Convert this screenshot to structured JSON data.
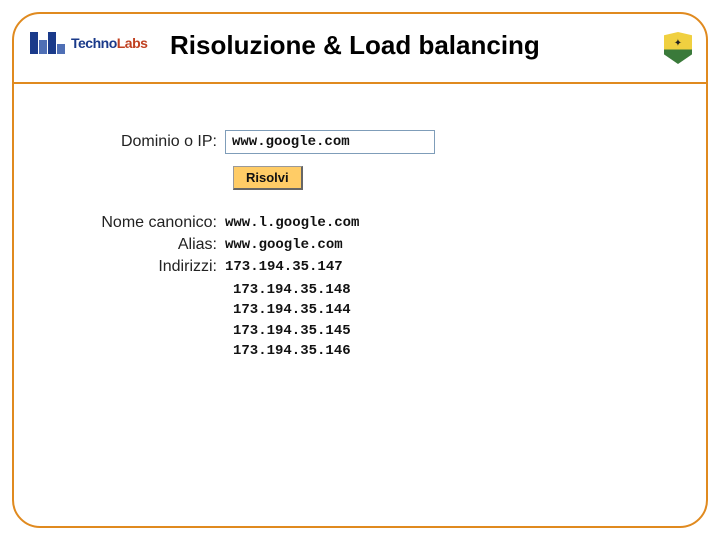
{
  "header": {
    "logo_text_main": "Techno",
    "logo_text_sub": "Labs",
    "title": "Risoluzione & Load balancing"
  },
  "form": {
    "domain_label": "Dominio o IP:",
    "domain_value": "www.google.com",
    "resolve_label": "Risolvi"
  },
  "results": {
    "canonical_label": "Nome canonico:",
    "canonical_value": "www.l.google.com",
    "alias_label": "Alias:",
    "alias_value": "www.google.com",
    "addresses_label": "Indirizzi:",
    "addresses": {
      "0": "173.194.35.147",
      "1": "173.194.35.148",
      "2": "173.194.35.144",
      "3": "173.194.35.145",
      "4": "173.194.35.146"
    }
  }
}
